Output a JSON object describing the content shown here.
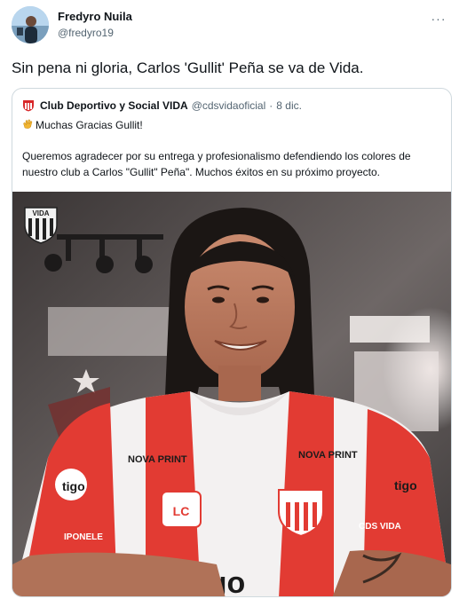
{
  "tweet": {
    "author_name": "Fredyro Nuila",
    "author_handle": "@fredyro19",
    "text": "Sin pena ni gloria, Carlos 'Gullit' Peña se va de Vida.",
    "more_label": "···"
  },
  "quote": {
    "author_name": "Club Deportivo y Social VIDA",
    "author_handle": "@cdsvidaoficial",
    "separator": "·",
    "date": "8 dic.",
    "line1": "Muchas Gracias Gullit!",
    "body": "Queremos agradecer por su entrega y profesionalismo defendiendo los colores de nuestro club a Carlos \"Gullit\" Peña\". Muchos éxitos en su próximo proyecto."
  },
  "photo": {
    "crest_text": "VIDA",
    "sponsor_left": "NOVA PRINT",
    "sponsor_right": "NOVA PRINT",
    "sponsor_bottom": "tigo",
    "sleeve_left_text": "IPONELE",
    "sleeve_right_text": "CDS VIDA",
    "sleeve_logo_left": "tigo",
    "sleeve_logo_right": "tigo",
    "chest_logo": "LC"
  },
  "colors": {
    "text_primary": "#0f1419",
    "text_secondary": "#536471",
    "border": "#cfd9de",
    "jersey_red": "#e23b33"
  },
  "icons": {
    "more": "more-horizontal-icon",
    "club_logo": "club-vida-logo-icon",
    "clap": "clapping-hands-icon"
  }
}
